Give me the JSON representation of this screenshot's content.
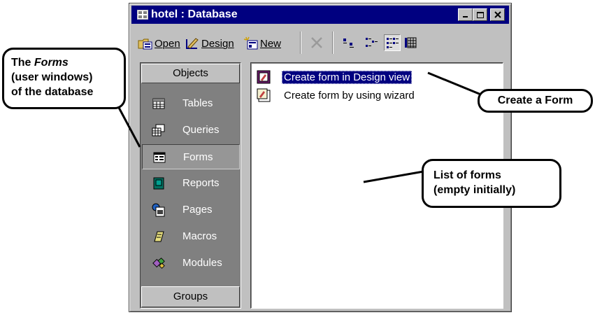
{
  "window": {
    "title": "hotel : Database",
    "title_icon": "database-icon"
  },
  "toolbar": {
    "open_label": "Open",
    "design_label": "Design",
    "new_label": "New",
    "delete_icon": "delete-x-icon",
    "view_icons": [
      "large-icons-view-icon",
      "small-icons-view-icon",
      "list-view-icon",
      "details-view-icon"
    ],
    "selected_view": "list-view-icon"
  },
  "objects_bar": {
    "header": "Objects",
    "items": [
      {
        "label": "Tables",
        "icon": "table-icon"
      },
      {
        "label": "Queries",
        "icon": "query-icon"
      },
      {
        "label": "Forms",
        "icon": "form-icon"
      },
      {
        "label": "Reports",
        "icon": "report-icon"
      },
      {
        "label": "Pages",
        "icon": "page-icon"
      },
      {
        "label": "Macros",
        "icon": "macro-icon"
      },
      {
        "label": "Modules",
        "icon": "module-icon"
      }
    ],
    "selected": "Forms",
    "groups_label": "Groups"
  },
  "list": {
    "items": [
      {
        "label": "Create form in Design view",
        "icon": "design-form-icon",
        "selected": true
      },
      {
        "label": "Create form by using wizard",
        "icon": "wizard-form-icon",
        "selected": false
      }
    ]
  },
  "callouts": {
    "forms_line1_prefix": "The ",
    "forms_line1_italic": "Forms",
    "forms_line2": "(user windows)",
    "forms_line3": "of the database",
    "create_form": "Create a Form",
    "list_line1": "List of forms",
    "list_line2": "(empty initially)"
  },
  "colors": {
    "titlebar": "#000080",
    "window_face": "#c0c0c0",
    "objects_bar": "#808080",
    "selection": "#000080"
  }
}
